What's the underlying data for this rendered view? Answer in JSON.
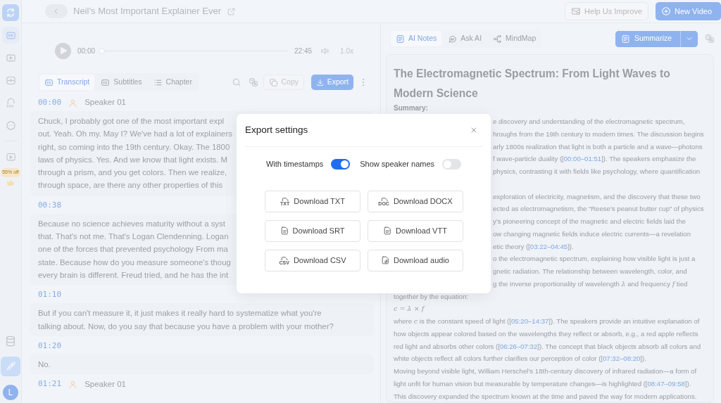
{
  "sidebar": {
    "items": [
      {
        "selected": true
      },
      {
        "selected": false
      },
      {
        "selected": false
      },
      {
        "selected": false
      },
      {
        "selected": false
      }
    ],
    "promo": {
      "badge": "55% off"
    },
    "bottom_items": [
      {
        "selected": false
      },
      {
        "selected": true
      }
    ],
    "avatar": "L"
  },
  "header": {
    "title": "Neil’s Most Important Explainer Ever",
    "buttons": [
      "Help Us Improve",
      "New Video"
    ]
  },
  "player": {
    "current": "00:00",
    "level": 0,
    "duration": "22:45",
    "speed": "1.0x"
  },
  "transcript_tabs": [
    {
      "label": "Transcript",
      "selected": true
    },
    {
      "label": "Subtitles",
      "selected": false
    },
    {
      "label": "Chapter",
      "selected": false
    }
  ],
  "transcript_actions": [
    "Copy",
    "Export"
  ],
  "transcript": [
    {
      "time": "00:00",
      "speaker": "Speaker 01",
      "lines": [
        "Chuck, I probably got one of the most important expl",
        "out. Yeah. Oh my. May I? We've had a lot of explainers",
        "right, so coming into the 19th century. Okay. The 1800",
        "laws of physics. Yes. And we know that light exists. M",
        "through a prism, and you get colors. Then we realize,",
        "through space, are there any other properties of this"
      ]
    },
    {
      "time": "00:38",
      "lines": [
        "Because no science achieves maturity without a syst",
        "that. That's not me. That's Logan Clendenning. Logan",
        "one of the forces that prevented psychology From ma",
        "state. Because how do you measure someone's thoug",
        "every brain is different. Freud tried, and he has the int"
      ]
    },
    {
      "time": "01:10",
      "lines": [
        "But if you can't measure it, it just makes it really hard to systematize what you're",
        "talking about. Now, do you say that because you have a problem with your mother?"
      ]
    },
    {
      "time": "01:20",
      "lines": [
        "No."
      ]
    },
    {
      "time": "01:21",
      "speaker": "Speaker 01"
    }
  ],
  "notes_tabs": [
    {
      "label": "AI Notes",
      "selected": true
    },
    {
      "label": "Ask AI",
      "selected": false
    },
    {
      "label": "MindMap",
      "selected": false
    }
  ],
  "summarize": {
    "label": "Summarize"
  },
  "notes": {
    "title": "The Electromagnetic Spectrum: From Light Waves to Modern Science",
    "heading": "Summary:",
    "covered_blocks": [
      [
        [
          {
            "kind": "plain",
            "text": "e discovery and understanding of the electromagnetic spectrum,"
          }
        ],
        [
          {
            "kind": "plain",
            "text": "hroughs from the 19th century to modern times. The discussion begins"
          }
        ],
        [
          {
            "kind": "plain",
            "text": "arly 1800s realization that light is both a particle and a wave—photons"
          }
        ],
        [
          {
            "kind": "plain",
            "text": "f wave-particle duality (["
          },
          {
            "kind": "time",
            "text": "00:00–01:51"
          },
          {
            "kind": "plain",
            "text": "]). The speakers emphasize the"
          }
        ],
        [
          {
            "kind": "plain",
            "text": "physics, contrasting it with fields like psychology, where quantification"
          }
        ]
      ],
      [
        [
          {
            "kind": "plain",
            "text": "exploration of electricity, magnetism, and the discovery that these two"
          }
        ],
        [
          {
            "kind": "plain",
            "text": "ected as electromagnetism, the “Reese’s peanut butter cup” of physics"
          }
        ],
        [
          {
            "kind": "plain",
            "text": "y’s pioneering concept of the magnetic and electric fields laid the"
          }
        ],
        [
          {
            "kind": "plain",
            "text": "ow changing magnetic fields induce electric currents—a revelation"
          }
        ],
        [
          {
            "kind": "plain",
            "text": "etic theory (["
          },
          {
            "kind": "time",
            "text": "03:22–04:45"
          },
          {
            "kind": "plain",
            "text": "])."
          }
        ],
        [
          {
            "kind": "plain",
            "text": "o the electromagnetic spectrum, explaining how visible light is just a"
          }
        ],
        [
          {
            "kind": "plain",
            "text": "gnetic radiation. The relationship between wavelength, color, and"
          }
        ],
        [
          {
            "kind": "plain",
            "text": "g the inverse proportionality of wavelength "
          },
          {
            "kind": "math",
            "text": "λ"
          },
          {
            "kind": "plain",
            "text": " and frequency "
          },
          {
            "kind": "math",
            "text": "f"
          },
          {
            "kind": "plain",
            "text": " tied"
          }
        ]
      ]
    ],
    "lines": [
      [
        {
          "kind": "plain",
          "text": "together by the equation:"
        }
      ],
      [
        {
          "kind": "math",
          "text": "c = λ × f"
        }
      ],
      [
        {
          "kind": "plain",
          "text": "where "
        },
        {
          "kind": "math",
          "text": "c"
        },
        {
          "kind": "plain",
          "text": " is the constant speed of light (["
        },
        {
          "kind": "time",
          "text": "05:20–14:37"
        },
        {
          "kind": "plain",
          "text": "]). The speakers provide an intuitive explanation of"
        }
      ],
      [
        {
          "kind": "plain",
          "text": "how objects appear colored based on the wavelengths they reflect or absorb, e.g., a red apple reflects"
        }
      ],
      [
        {
          "kind": "plain",
          "text": "red light and absorbs other colors (["
        },
        {
          "kind": "time",
          "text": "06:26–07:32"
        },
        {
          "kind": "plain",
          "text": "]). The concept that black objects absorb all colors and"
        }
      ],
      [
        {
          "kind": "plain",
          "text": "white objects reflect all colors further clarifies our perception of color (["
        },
        {
          "kind": "time",
          "text": "07:32–08:20"
        },
        {
          "kind": "plain",
          "text": "])."
        }
      ],
      [
        {
          "kind": "plain",
          "text": "Moving beyond visible light, William Herschel’s 18th-century discovery of infrared radiation—a form of"
        }
      ],
      [
        {
          "kind": "plain",
          "text": "light unfit for human vision but measurable by temperature changes—is highlighted (["
        },
        {
          "kind": "time",
          "text": "08:47–09:58"
        },
        {
          "kind": "plain",
          "text": "])."
        }
      ],
      [
        {
          "kind": "plain",
          "text": "This discovery expanded the spectrum known at the time and paved the way for modern applications."
        }
      ]
    ]
  },
  "modal": {
    "title": "Export settings",
    "options": [
      {
        "label": "With timestamps",
        "on": true
      },
      {
        "label": "Show speaker names",
        "on": false
      }
    ],
    "downloads": [
      {
        "label": "Download TXT",
        "kind": "tagged",
        "tag": "TXT"
      },
      {
        "label": "Download DOCX",
        "kind": "tagged",
        "tag": "DOC"
      },
      {
        "label": "Download SRT",
        "kind": "doc"
      },
      {
        "label": "Download VTT",
        "kind": "doc"
      },
      {
        "label": "Download CSV",
        "kind": "tagged",
        "tag": "CSV"
      },
      {
        "label": "Download audio",
        "kind": "audio"
      }
    ]
  }
}
